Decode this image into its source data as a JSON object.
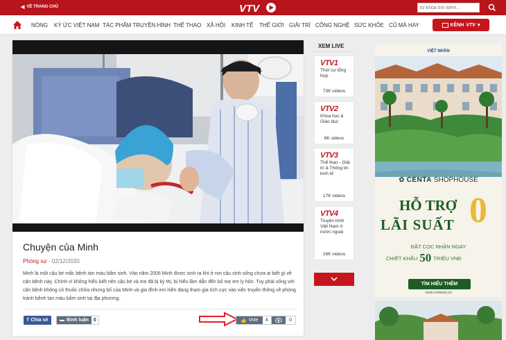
{
  "topbar": {
    "home_label": "VỀ TRANG CHỦ",
    "search_placeholder": "từ khóa tìm kiếm..."
  },
  "logo": {
    "text": "VTV"
  },
  "nav": {
    "items": [
      "NÓNG",
      "KÝ ỨC VIỆT NAM",
      "TÁC PHẨM TRUYỀN HÌNH",
      "THỂ THAO",
      "XÃ HỘI",
      "KINH TẾ",
      "THẾ GIỚI",
      "GIẢI TRÍ",
      "CÔNG NGHỆ",
      "SỨC KHỎE",
      "CŨ MÀ HAY"
    ],
    "channel_button": {
      "label": "KÊNH",
      "logo": "VTV"
    }
  },
  "article": {
    "title": "Chuyện của Minh",
    "category": "Phóng sự",
    "date": "- 02/12/2020",
    "description": "Minh là một cậu bé mắc bệnh tan máu bẩm sinh. Vào năm 2006 Minh được sinh ra khi ở nơi cậu sinh sống chưa ai biết gì về căn bệnh này. Chính vì không hiểu biết nên cậu bé và mẹ đã bị kỳ thị, bị hiểu lầm dẫn đến bố mẹ em ly hôn. Tuy phải sống với căn bệnh không có thuốc chữa nhưng bố của Minh và gia đình em hiện đang tham gia tích cực vào việc truyền thông về phòng tránh bệnh tan máu bẩm sinh tại địa phương.",
    "share_label": "Chia sẻ",
    "comment_label": "Bình luận",
    "comment_count": "0",
    "vote_label": "Vote",
    "vote_count": "4",
    "view_count": "0"
  },
  "live": {
    "title": "XEM LIVE",
    "channels": [
      {
        "logo": "VTV1",
        "name": "Thời sự tổng hợp",
        "views": "73K videos"
      },
      {
        "logo": "VTV2",
        "name": "Khoa học & Giáo dục",
        "views": "8K videos"
      },
      {
        "logo": "VTV3",
        "name": "Thể thao - Giải trí & Thông tin kinh tế",
        "views": "17K videos"
      },
      {
        "logo": "VTV4",
        "name": "Truyền hình Việt Nam ở nước ngoài",
        "views": "16K videos"
      }
    ]
  },
  "ad": {
    "brand": "VIỆT NHÂN",
    "logo_name": "CENTA",
    "logo_suffix": "SHOPHOUSE",
    "headline1": "HỖ TRỢ",
    "headline2": "LÃI SUẤT",
    "headline_big": "0",
    "line1": "ĐẶT CỌC NHẬN NGAY",
    "line2_prefix": "CHIẾT KHẤU",
    "line2_big": "50",
    "line2_suffix": "TRIỆU VNĐ",
    "cta": "TÌM HIỂU THÊM",
    "url": "www.centacity.vn"
  },
  "colors": {
    "brand_red": "#c4161c",
    "topbar_red": "#b7141b",
    "ad_green": "#1b5e20",
    "ad_gold": "#e8b93a"
  }
}
